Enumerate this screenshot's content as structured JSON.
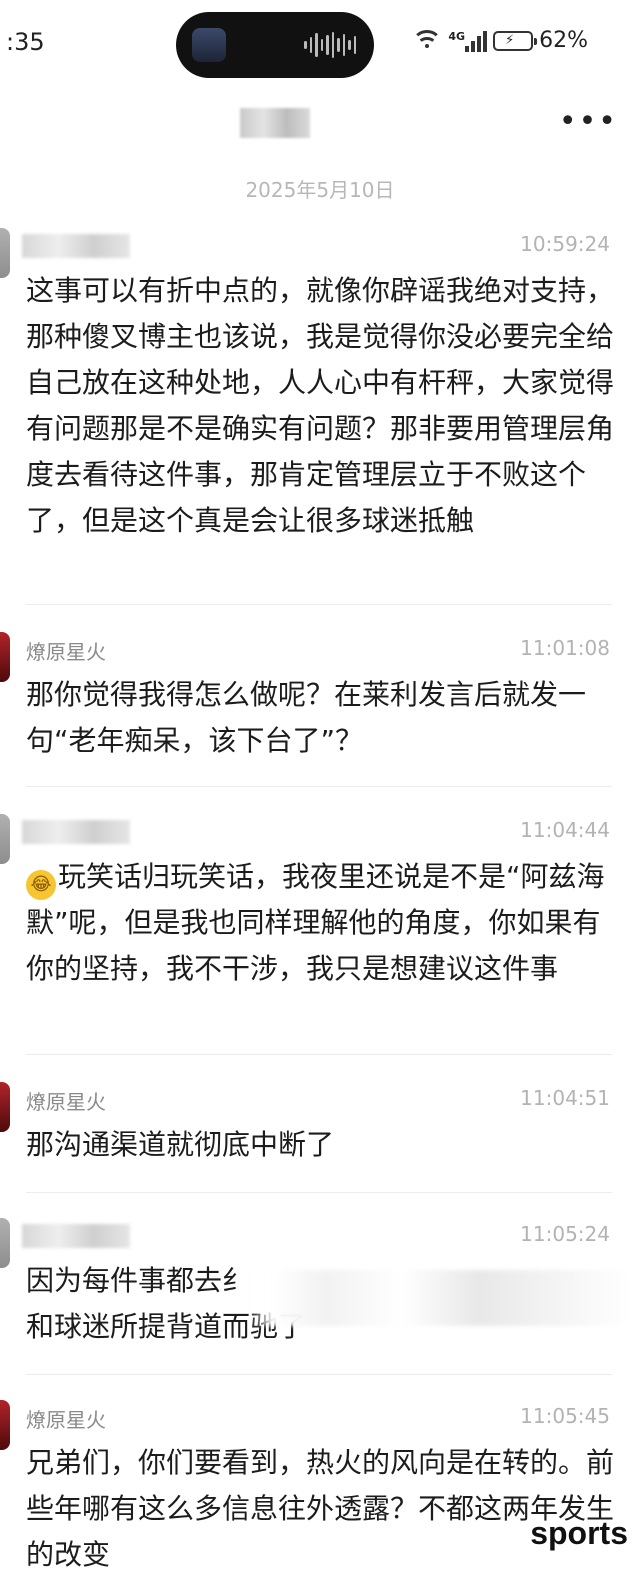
{
  "status_bar": {
    "time": ":35",
    "network_label": "4G",
    "battery_percent": "62%",
    "icons": [
      "media-thumbnail-icon",
      "audio-wave-icon",
      "wifi-icon",
      "signal-icon",
      "battery-charging-icon"
    ]
  },
  "header": {
    "more_label": "•••"
  },
  "date_separator": "2025年5月10日",
  "messages": [
    {
      "sender": "",
      "time": "10:59:24",
      "text": "这事可以有折中点的，就像你辟谣我绝对支持，那种傻叉博主也该说，我是觉得你没必要完全给自己放在这种处地，人人心中有杆秤，大家觉得有问题那是不是确实有问题？那非要用管理层角度去看待这件事，那肯定管理层立于不败这个了，但是这个真是会让很多球迷抵触"
    },
    {
      "sender": "燎原星火",
      "time": "11:01:08",
      "text": "那你觉得我得怎么做呢？在莱利发言后就发一句“老年痴呆，该下台了”？"
    },
    {
      "sender": "",
      "time": "11:04:44",
      "emoji": "laughing-tears-emoji",
      "text": "玩笑话归玩笑话，我夜里还说是不是“阿兹海默”呢，但是我也同样理解他的角度，你如果有你的坚持，我不干涉，我只是想建议这件事"
    },
    {
      "sender": "燎原星火",
      "time": "11:04:51",
      "text": "那沟通渠道就彻底中断了"
    },
    {
      "sender": "",
      "time": "11:05:24",
      "text": "因为每件事都去纟\n和球迷所提背道而驰了"
    },
    {
      "sender": "燎原星火",
      "time": "11:05:45",
      "text": "兄弟们，你们要看到，热火的风向是在转的。前些年哪有这么多信息往外透露？不都这两年发生的改变"
    }
  ],
  "watermark": "sports"
}
